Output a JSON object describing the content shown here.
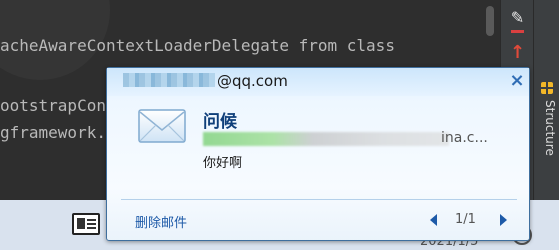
{
  "editor": {
    "lines": [
      {
        "text": "acheAwareContextLoaderDelegate from class"
      },
      {
        "text": "ootstrapCon"
      },
      {
        "text": "gframework."
      }
    ]
  },
  "sidebar": {
    "structure_label": "Structure"
  },
  "notification": {
    "sender_suffix": "@qq.com",
    "close_label": "×",
    "subject": "问候",
    "from_suffix": "ina.c...",
    "body": "你好啊",
    "delete_label": "删除邮件",
    "pager": "1/1"
  },
  "taskbar": {
    "clock": "2021/1/5"
  },
  "colors": {
    "accent": "#1d5aa8",
    "title": "#0f3f7a",
    "popup_border": "#3f6f9e"
  },
  "icons": [
    "pencil-icon",
    "up-arrow-icon",
    "structure-icon",
    "mail-envelope-icon",
    "news-icon",
    "tray-icon"
  ]
}
